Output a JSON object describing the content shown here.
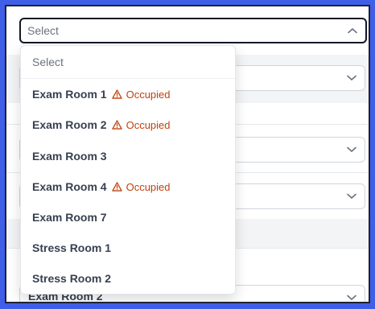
{
  "select": {
    "placeholder": "Select",
    "options": [
      {
        "label": "Select"
      },
      {
        "label": "Exam Room 1",
        "status": "Occupied"
      },
      {
        "label": "Exam Room 2",
        "status": "Occupied"
      },
      {
        "label": "Exam Room 3"
      },
      {
        "label": "Exam Room 4",
        "status": "Occupied"
      },
      {
        "label": "Exam Room 7"
      },
      {
        "label": "Stress Room 1"
      },
      {
        "label": "Stress Room 2"
      }
    ]
  },
  "background": {
    "bottom_value": "Exam Room 2"
  },
  "colors": {
    "warning": "#c2410c",
    "border_active": "#111827",
    "frame_bg": "#3f5fe6"
  },
  "icons": {
    "chevron_up": "chevron-up-icon",
    "chevron_down": "chevron-down-icon",
    "warning": "warning-triangle-icon"
  }
}
